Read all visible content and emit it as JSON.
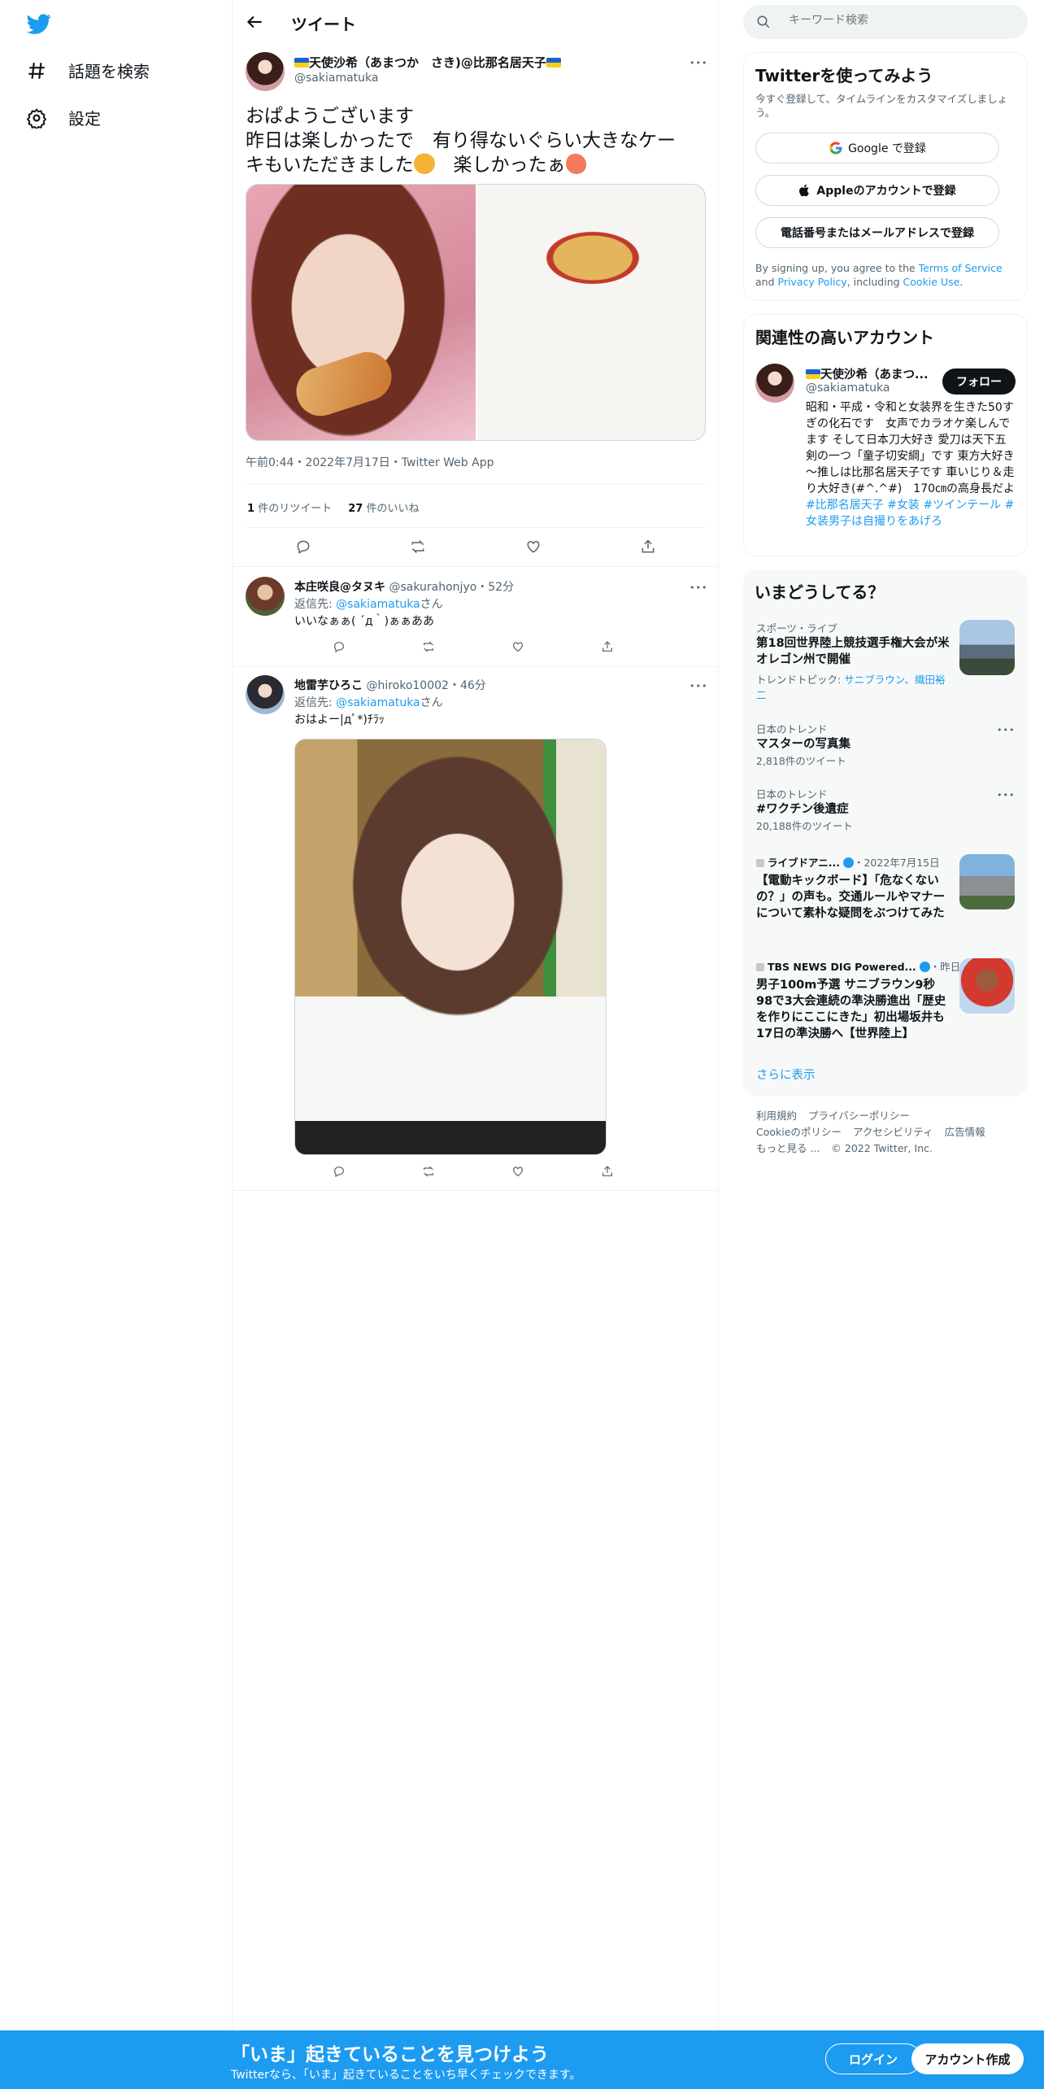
{
  "nav": {
    "logo": "twitter-bird-icon",
    "items": [
      {
        "icon": "hashtag-icon",
        "label": "話題を検索"
      },
      {
        "icon": "gear-icon",
        "label": "設定"
      }
    ]
  },
  "header": {
    "title": "ツイート"
  },
  "tweet": {
    "display_name": "天使沙希（あまつか　さき)@比那名居天子",
    "handle": "@sakiamatuka",
    "text_line1": "おぱようございます",
    "text_line2": "昨日は楽しかったで　有り得ないぐらい大きなケー",
    "text_line3": "キもいただきました",
    "text_line3_tail": "　楽しかったぁ",
    "meta": "午前0:44・2022年7月17日・Twitter Web App",
    "retweet_count": "1",
    "retweet_label": "件のリツイート",
    "like_count": "27",
    "like_label": "件のいいね"
  },
  "replies": [
    {
      "display_name": "本庄咲良@タヌキ",
      "handle_time": "@sakurahonjyo・52分",
      "reply_prefix": "返信先: ",
      "reply_to": "@sakiamatuka",
      "reply_suffix": "さん",
      "text": "いいなぁぁ( ´д｀)ぁぁああ"
    },
    {
      "display_name": "地雷芋ひろこ",
      "handle_time": "@hiroko10002・46分",
      "reply_prefix": "返信先: ",
      "reply_to": "@sakiamatuka",
      "reply_suffix": "さん",
      "text": "おはよー|дﾟ*)ﾁﾗｯ"
    }
  ],
  "search": {
    "placeholder": "キーワード検索"
  },
  "signup_card": {
    "title": "Twitterを使ってみよう",
    "subtitle": "今すぐ登録して、タイムラインをカスタマイズしましょう。",
    "google": "Google で登録",
    "apple": "Appleのアカウントで登録",
    "phone": "電話番号またはメールアドレスで登録",
    "terms_prefix": "By signing up, you agree to the ",
    "terms_link": "Terms of Service",
    "terms_and": " and ",
    "privacy_link": "Privacy Policy",
    "including": ", including ",
    "cookie_link": "Cookie Use",
    "period": "."
  },
  "related": {
    "title": "関連性の高いアカウント",
    "name": "天使沙希（あまつ...",
    "handle": "@sakiamatuka",
    "follow": "フォロー",
    "bio": "昭和・平成・令和と女装界を生きた50すぎの化石です　女声でカラオケ楽しんでます そして日本刀大好き 愛刀は天下五剣の一つ「童子切安綱」です 東方大好き～推しは比那名居天子です 車いじり＆走り大好き(#^.^#)　170㎝の高身長だよ",
    "tags": "#比那名居天子 #女装 #ツインテール #女装男子は自撮りをあげろ"
  },
  "trends": {
    "title": "いまどうしてる？",
    "items": [
      {
        "category": "スポーツ・ライブ",
        "title": "第18回世界陸上競技選手権大会が米オレゴン州で開催",
        "sub_prefix": "トレンドトピック: ",
        "sub_links": "サニブラウン、織田裕二"
      },
      {
        "category": "日本のトレンド",
        "title": "マスターの写真集",
        "count": "2,818件のツイート"
      },
      {
        "category": "日本のトレンド",
        "title": "#ワクチン後遺症",
        "count": "20,188件のツイート"
      },
      {
        "source": "ライブドアニ...",
        "date": "・2022年7月15日",
        "title": "【電動キックボード】「危なくないの？」の声も。交通ルールやマナーについて素朴な疑問をぶつけてみた"
      },
      {
        "source": "TBS NEWS DIG Powered...",
        "date": "・昨日",
        "title": "男子100m予選 サニブラウン9秒98で3大会連続の準決勝進出「歴史を作りにここにきた」初出場坂井も17日の準決勝へ【世界陸上】"
      }
    ],
    "show_more": "さらに表示"
  },
  "footer": {
    "l1a": "利用規約",
    "l1b": "プライバシーポリシー",
    "l2a": "Cookieのポリシー",
    "l2b": "アクセシビリティ",
    "l2c": "広告情報",
    "l3a": "もっと見る ...",
    "l3b": "© 2022 Twitter, Inc."
  },
  "bottombar": {
    "title": "「いま」起きていることを見つけよう",
    "subtitle": "Twitterなら、「いま」起きていることをいち早くチェックできます。",
    "login": "ログイン",
    "signup": "アカウント作成"
  },
  "colors": {
    "accent": "#1d9bf0",
    "text": "#0f1419",
    "muted": "#536471",
    "border": "#eff3f4"
  }
}
